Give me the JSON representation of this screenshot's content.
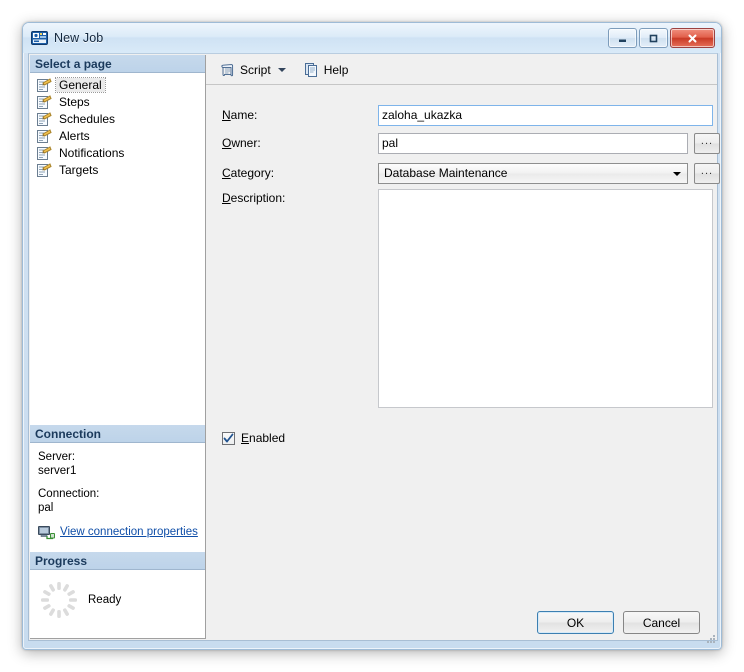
{
  "window": {
    "title": "New Job",
    "icon": "ssms-job-icon",
    "controls": {
      "minimize": "minimize-button",
      "maximize": "maximize-button",
      "close": "close-button"
    }
  },
  "sidebar": {
    "header": "Select a page",
    "items": [
      {
        "label": "General",
        "selected": true
      },
      {
        "label": "Steps",
        "selected": false
      },
      {
        "label": "Schedules",
        "selected": false
      },
      {
        "label": "Alerts",
        "selected": false
      },
      {
        "label": "Notifications",
        "selected": false
      },
      {
        "label": "Targets",
        "selected": false
      }
    ],
    "connection": {
      "header": "Connection",
      "server_label": "Server:",
      "server_value": "server1",
      "connection_label": "Connection:",
      "connection_value": "pal",
      "properties_link": "View connection properties"
    },
    "progress": {
      "header": "Progress",
      "status": "Ready"
    }
  },
  "toolbar": {
    "script_label": "Script",
    "help_label": "Help"
  },
  "form": {
    "name": {
      "label_mnemonic": "N",
      "label_rest": "ame:",
      "value": "zaloha_ukazka",
      "focused": true
    },
    "owner": {
      "label_mnemonic": "O",
      "label_rest": "wner:",
      "value": "pal",
      "browse": "..."
    },
    "category": {
      "label_mnemonic": "C",
      "label_rest": "ategory:",
      "value": "Database Maintenance",
      "browse": "..."
    },
    "description": {
      "label_mnemonic": "D",
      "label_rest": "escription:",
      "value": ""
    },
    "enabled": {
      "label_mnemonic": "E",
      "label_rest": "nabled",
      "checked": true
    }
  },
  "footer": {
    "ok_label": "OK",
    "cancel_label": "Cancel"
  },
  "colors": {
    "accent": "#0f4ea8",
    "panel_header": "#c6d9ec",
    "focus_border": "#7eb4ea",
    "close_button": "#c93a26"
  }
}
